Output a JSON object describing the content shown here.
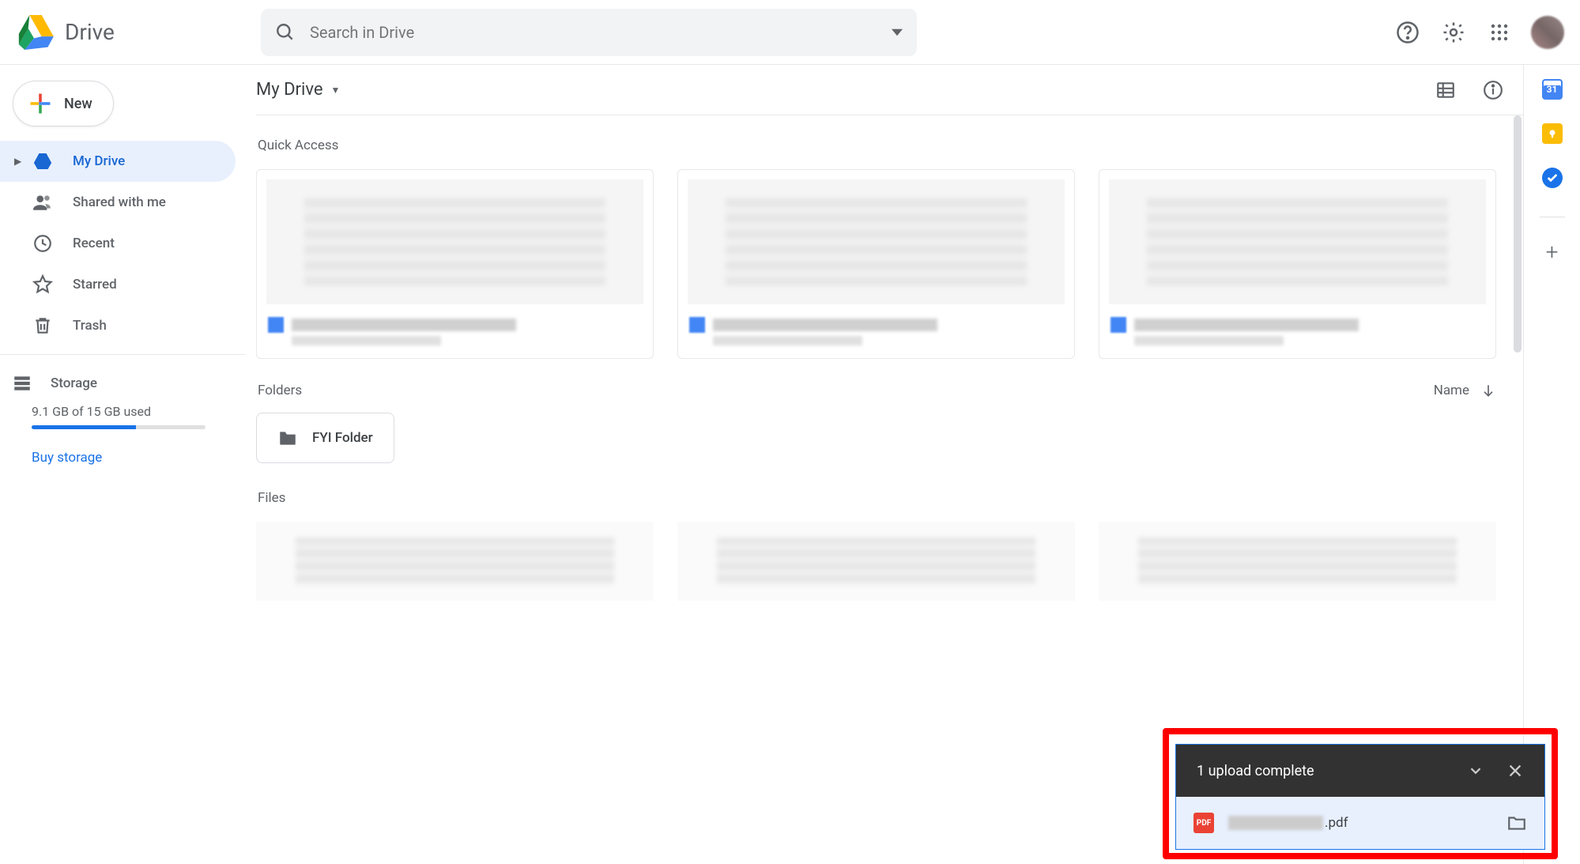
{
  "header": {
    "product": "Drive",
    "search_placeholder": "Search in Drive"
  },
  "sidebar": {
    "new_label": "New",
    "items": [
      {
        "label": "My Drive",
        "icon": "drive",
        "active": true,
        "expandable": true
      },
      {
        "label": "Shared with me",
        "icon": "people"
      },
      {
        "label": "Recent",
        "icon": "clock"
      },
      {
        "label": "Starred",
        "icon": "star"
      },
      {
        "label": "Trash",
        "icon": "trash"
      }
    ],
    "storage_label": "Storage",
    "storage_text": "9.1 GB of 15 GB used",
    "storage_percent": 60,
    "buy_label": "Buy storage"
  },
  "breadcrumb": "My Drive",
  "quick_access_label": "Quick Access",
  "folders_label": "Folders",
  "sort_label": "Name",
  "folders": [
    {
      "name": "FYI Folder"
    }
  ],
  "files_label": "Files",
  "upload": {
    "title": "1 upload complete",
    "file_ext": ".pdf",
    "file_type_badge": "PDF"
  },
  "right_rail": {
    "calendar_day": "31"
  }
}
